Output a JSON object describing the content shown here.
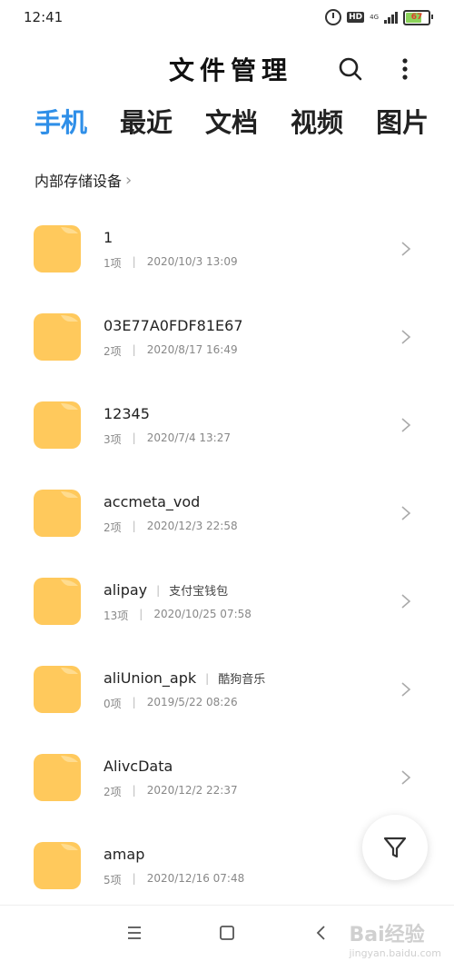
{
  "status_bar": {
    "time": "12:41",
    "network": "4G",
    "hd": "HD",
    "battery": "67"
  },
  "header": {
    "title": "文件管理"
  },
  "tabs": [
    {
      "label": "手机",
      "active": true
    },
    {
      "label": "最近",
      "active": false
    },
    {
      "label": "文档",
      "active": false
    },
    {
      "label": "视频",
      "active": false
    },
    {
      "label": "图片",
      "active": false
    }
  ],
  "breadcrumb": {
    "label": "内部存储设备"
  },
  "files": [
    {
      "name": "1",
      "alias": "",
      "count": "1项",
      "date": "2020/10/3 13:09"
    },
    {
      "name": "03E77A0FDF81E67",
      "alias": "",
      "count": "2项",
      "date": "2020/8/17 16:49"
    },
    {
      "name": "12345",
      "alias": "",
      "count": "3项",
      "date": "2020/7/4 13:27"
    },
    {
      "name": "accmeta_vod",
      "alias": "",
      "count": "2项",
      "date": "2020/12/3 22:58"
    },
    {
      "name": "alipay",
      "alias": "支付宝钱包",
      "count": "13项",
      "date": "2020/10/25 07:58"
    },
    {
      "name": "aliUnion_apk",
      "alias": "酷狗音乐",
      "count": "0项",
      "date": "2019/5/22 08:26"
    },
    {
      "name": "AlivcData",
      "alias": "",
      "count": "2项",
      "date": "2020/12/2 22:37"
    },
    {
      "name": "amap",
      "alias": "",
      "count": "5项",
      "date": "2020/12/16 07:48"
    }
  ],
  "watermark": {
    "brand": "Bai",
    "suffix": "经验",
    "site": "jingyan.baidu.com"
  },
  "colors": {
    "accent": "#2f8fe8",
    "folder": "#ffc95c"
  }
}
